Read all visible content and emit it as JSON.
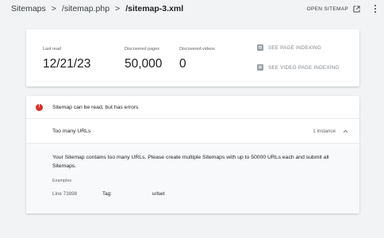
{
  "breadcrumb": {
    "items": [
      "Sitemaps",
      "/sitemap.php",
      "/sitemap-3.xml"
    ],
    "separator": ">"
  },
  "header_actions": {
    "open_sitemap_label": "OPEN SITEMAP",
    "open_icon": "open-in-new-icon",
    "more_icon": "more-vert-icon"
  },
  "stats": {
    "last_read": {
      "label": "Last read",
      "value": "12/21/23"
    },
    "discovered_pages": {
      "label": "Discovered pages",
      "value": "50,000"
    },
    "discovered_videos": {
      "label": "Discovered videos",
      "value": "0"
    }
  },
  "actions": {
    "see_page_indexing": "SEE PAGE INDEXING",
    "see_video_page_indexing": "SEE VIDEO PAGE INDEXING"
  },
  "error": {
    "status": "Sitemap can be read, but has errors",
    "color": "#d93025",
    "issue": {
      "name": "Too many URLs",
      "count": "1 instance",
      "description": "Your Sitemap contains too many URLs. Please create multiple Sitemaps with up to 50000 URLs each and submit all Sitemaps.",
      "examples_label": "Examples",
      "example": {
        "line": "Line 73898",
        "tag_label": "Tag:",
        "tag_value": "urlset"
      }
    }
  }
}
